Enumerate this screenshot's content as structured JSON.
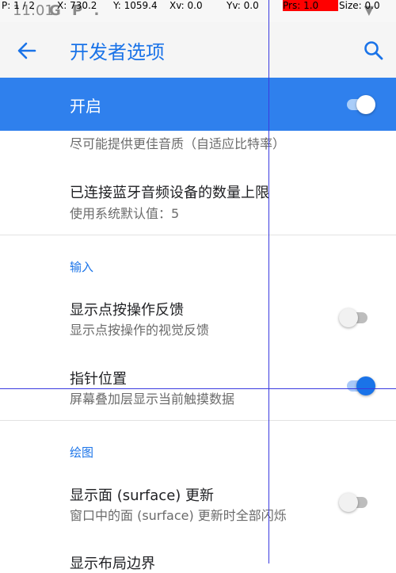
{
  "overlay": {
    "p": "P: 1 / 2",
    "x": "X: 730.2",
    "y": "Y: 1059.4",
    "xv": "Xv: 0.0",
    "yv": "Yv: 0.0",
    "prs": "Prs: 1.0",
    "size": "Size: 0.0"
  },
  "status_bar": {
    "clock": "11:01",
    "icons": "G P ."
  },
  "app_bar": {
    "title": "开发者选项"
  },
  "master_switch": {
    "label": "开启",
    "checked": true
  },
  "rows": {
    "audio_quality_summary": "尽可能提供更佳音质（自适应比特率）",
    "bt_limit": {
      "title": "已连接蓝牙音频设备的数量上限",
      "summary": "使用系统默认值：5"
    }
  },
  "input": {
    "category": "输入",
    "show_taps": {
      "title": "显示点按操作反馈",
      "summary": "显示点按操作的视觉反馈",
      "checked": false
    },
    "pointer_location": {
      "title": "指针位置",
      "summary": "屏幕叠加层显示当前触摸数据",
      "checked": true
    }
  },
  "drawing": {
    "category": "绘图",
    "surface_updates": {
      "title": "显示面 (surface) 更新",
      "summary": "窗口中的面 (surface) 更新时全部闪烁",
      "checked": false
    },
    "layout_bounds": {
      "title": "显示布局边界"
    }
  },
  "colors": {
    "accent": "#1a73e8",
    "master_bar": "#2f80ed"
  }
}
